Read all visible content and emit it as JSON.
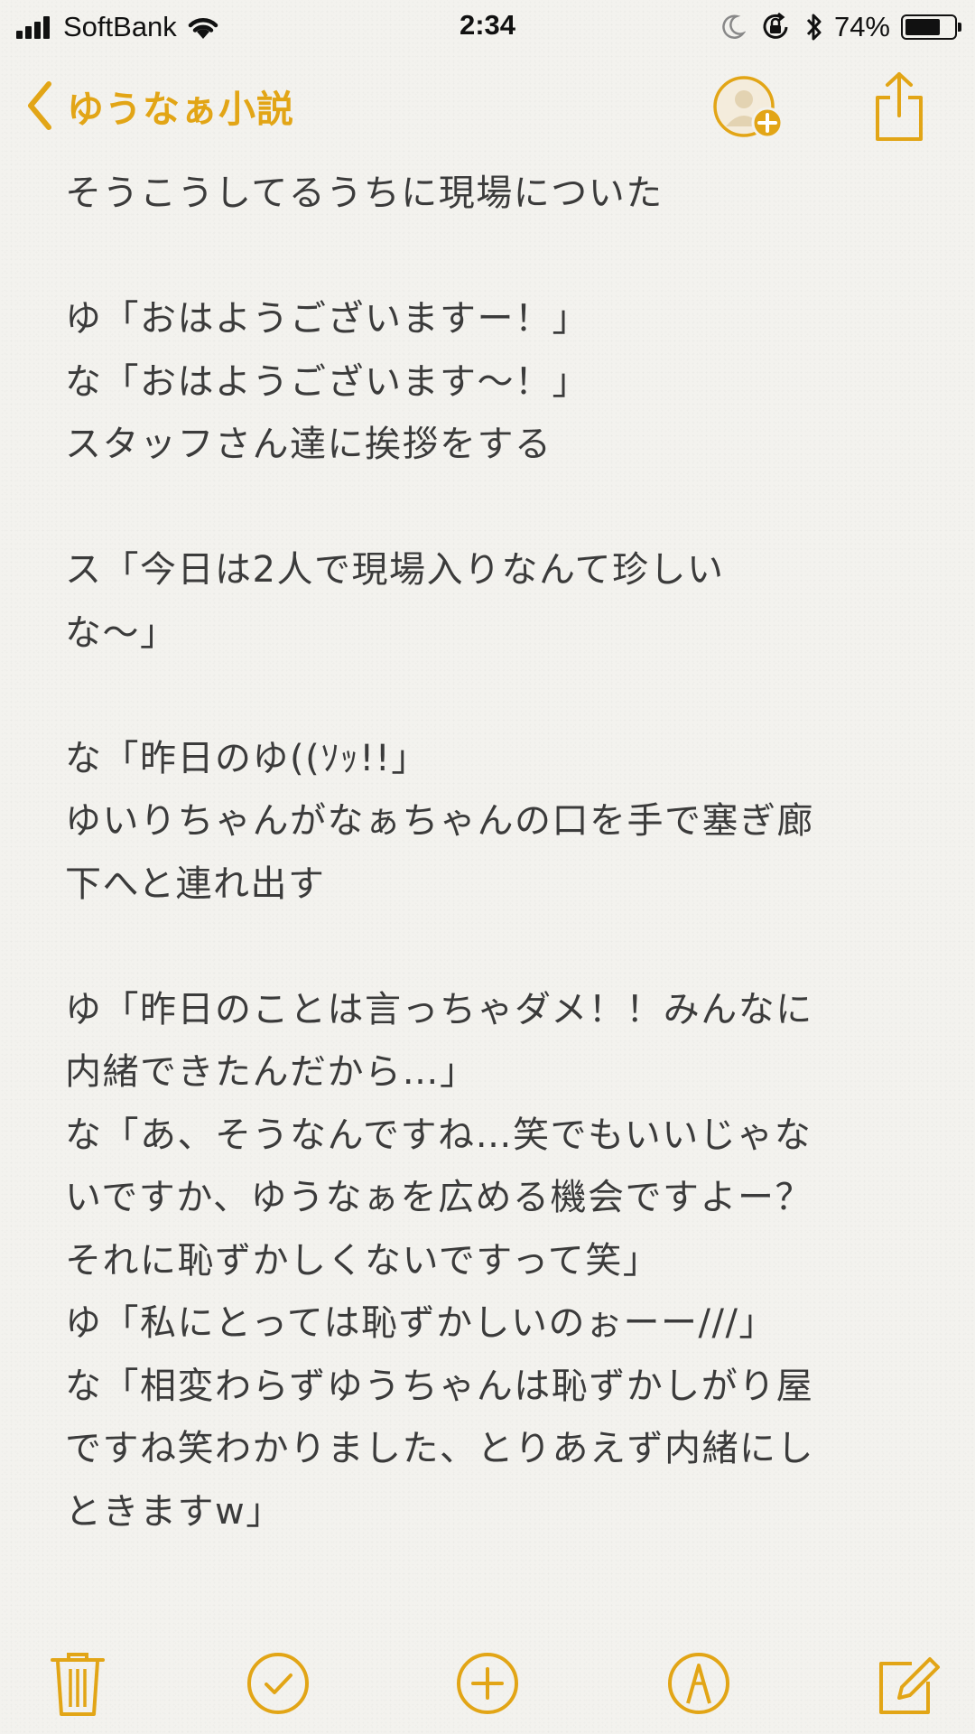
{
  "status_bar": {
    "carrier": "SoftBank",
    "time": "2:34",
    "battery_percent": "74%",
    "battery_level": 0.74,
    "icons": [
      "signal-icon",
      "wifi-icon",
      "moon-icon",
      "orientation-lock-icon",
      "bluetooth-icon",
      "battery-icon"
    ]
  },
  "nav": {
    "back_label": "ゆうなぁ小説",
    "icons": [
      "chevron-left-icon",
      "add-person-icon",
      "share-icon"
    ],
    "accent_color": "#e2a516"
  },
  "note": {
    "lines": [
      "そうこうしてるうちに現場についた",
      "",
      "ゆ「おはようございますー！」",
      "な「おはようございます〜！」",
      "スタッフさん達に挨拶をする",
      "",
      "ス「今日は2人で現場入りなんて珍しい",
      "な〜」",
      "",
      "な「昨日のゆ((ｿｯ!!」",
      "ゆいりちゃんがなぁちゃんの口を手で塞ぎ廊",
      "下へと連れ出す",
      "",
      "ゆ「昨日のことは言っちゃダメ！！みんなに",
      "内緒できたんだから…」",
      "な「あ、そうなんですね…笑でもいいじゃな",
      "いですか、ゆうなぁを広める機会ですよー？",
      "それに恥ずかしくないですって笑」",
      "ゆ「私にとっては恥ずかしいのぉーー///」",
      "な「相変わらずゆうちゃんは恥ずかしがり屋",
      "ですね笑わかりました、とりあえず内緒にし",
      "ときますw」"
    ]
  },
  "toolbar": {
    "icons": [
      "trash-icon",
      "checklist-icon",
      "add-icon",
      "markup-icon",
      "compose-icon"
    ]
  }
}
